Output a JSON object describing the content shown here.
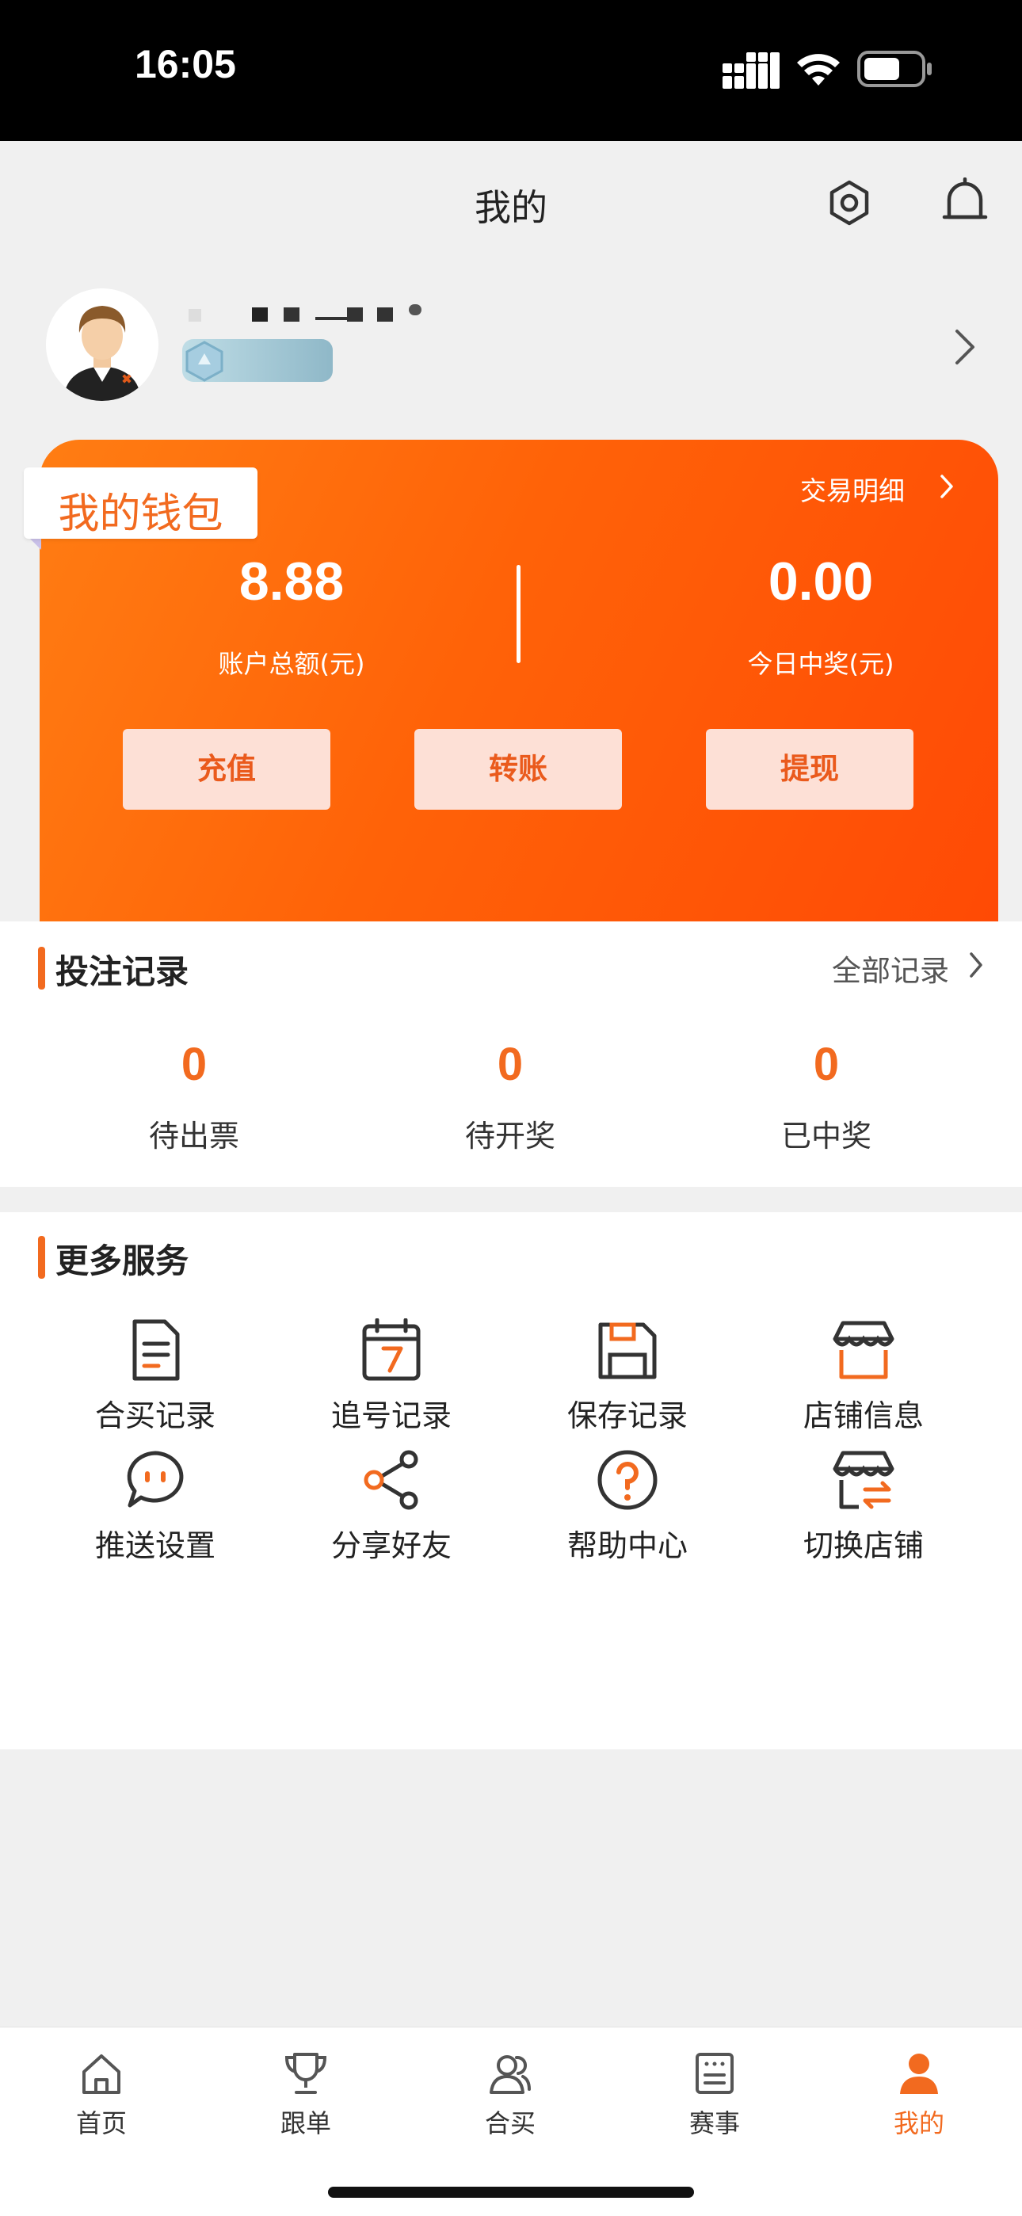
{
  "status_bar": {
    "time": "16:05"
  },
  "header": {
    "title": "我的"
  },
  "wallet": {
    "tag": "我的钱包",
    "details_link": "交易明细",
    "balance": "8.88",
    "balance_label": "账户总额(元)",
    "today_win": "0.00",
    "today_win_label": "今日中奖(元)",
    "buttons": [
      "充值",
      "转账",
      "提现"
    ]
  },
  "bet_records": {
    "title": "投注记录",
    "all_link": "全部记录",
    "stats": [
      {
        "value": "0",
        "label": "待出票"
      },
      {
        "value": "0",
        "label": "待开奖"
      },
      {
        "value": "0",
        "label": "已中奖"
      }
    ]
  },
  "services": {
    "title": "更多服务",
    "items": [
      {
        "label": "合买记录",
        "icon": "document-icon"
      },
      {
        "label": "追号记录",
        "icon": "calendar-icon"
      },
      {
        "label": "保存记录",
        "icon": "save-icon"
      },
      {
        "label": "店铺信息",
        "icon": "store-icon"
      },
      {
        "label": "推送设置",
        "icon": "chat-bubble-icon"
      },
      {
        "label": "分享好友",
        "icon": "share-icon"
      },
      {
        "label": "帮助中心",
        "icon": "help-icon"
      },
      {
        "label": "切换店铺",
        "icon": "switch-store-icon"
      }
    ]
  },
  "bottom_nav": {
    "items": [
      {
        "label": "首页",
        "icon": "home-icon"
      },
      {
        "label": "跟单",
        "icon": "trophy-icon"
      },
      {
        "label": "合买",
        "icon": "users-icon"
      },
      {
        "label": "赛事",
        "icon": "scoreboard-icon"
      },
      {
        "label": "我的",
        "icon": "person-icon"
      }
    ],
    "active_color": "#f26a1f",
    "inactive_color": "#555555"
  },
  "colors": {
    "accent": "#f26a1f",
    "wallet_gradient_start": "#ff7d13",
    "wallet_gradient_end": "#ff4a05",
    "button_bg": "#fde0d6"
  }
}
